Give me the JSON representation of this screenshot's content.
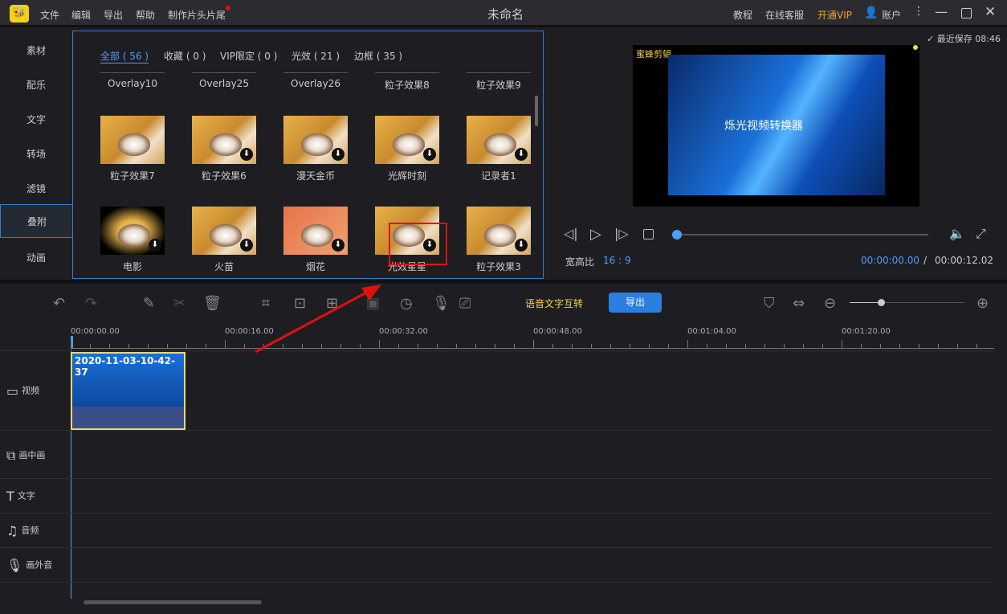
{
  "titlebar": {
    "logo": "🐝",
    "menus": [
      "文件",
      "编辑",
      "导出",
      "帮助",
      "制作片头片尾"
    ],
    "title": "未命名",
    "right": {
      "tutorial": "教程",
      "support": "在线客服",
      "vip": "开通VIP",
      "account": "账户"
    }
  },
  "sidebar": [
    "素材",
    "配乐",
    "文字",
    "转场",
    "滤镜",
    "叠附",
    "动画"
  ],
  "library": {
    "tabs": [
      "全部 ( 56 )",
      "收藏 ( 0 )",
      "VIP限定 ( 0 )",
      "光效 ( 21 )",
      "边框 ( 35 )"
    ],
    "row1": [
      "Overlay10",
      "Overlay25",
      "Overlay26",
      "粒子效果8",
      "粒子效果9"
    ],
    "row2": [
      "粒子效果7",
      "粒子效果6",
      "漫天金币",
      "光辉时刻",
      "记录者1"
    ],
    "row3": [
      "电影",
      "火苗",
      "烟花",
      "光效星星",
      "粒子效果3"
    ]
  },
  "preview": {
    "saved": "最近保存 08:46",
    "watermark": "蜜蜂剪辑",
    "app_text": "烁光视频转换器",
    "ratio_label": "宽高比",
    "ratio": "16 : 9",
    "current": "00:00:00.00",
    "sep": "/",
    "total": "00:00:12.02",
    "progress": 0
  },
  "toolbar": {
    "speech": "语音文字互转",
    "export": "导出"
  },
  "ruler": [
    "00:00:00.00",
    "00:00:16.00",
    "00:00:32.00",
    "00:00:48.00",
    "00:01:04.00",
    "00:01:20.00"
  ],
  "tracks": [
    "视频",
    "画中画",
    "文字",
    "音频",
    "画外音"
  ],
  "clip": {
    "name": "2020-11-03-10-42-37"
  },
  "colors": {
    "accent": "#3a8bea",
    "vip": "#f0a030",
    "speech": "#f5d04a",
    "highlight": "#e01010"
  }
}
